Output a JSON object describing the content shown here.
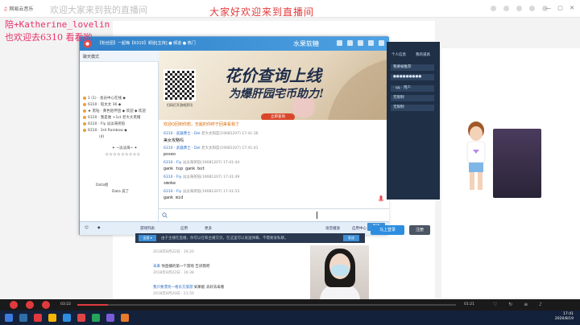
{
  "overlays": {
    "top_left_faint": "欢迎大家来到我的直播间",
    "top_center_red": "大家好欢迎来到直播间",
    "user_line": "陪+Katherine_lovelin",
    "welcome_line": "也欢迎去6310 看看哟"
  },
  "app": {
    "logo_prefix": "♫",
    "logo_name": "网易云音乐"
  },
  "yy": {
    "room_title": "【粉丝团】一起嗨【6310】频道[主持] ● 频道 ● 热门",
    "brand": "水果软糖",
    "list_mode": "聊天模式",
    "members": [
      "1 (1)  · 会员中心在线 ◆ ",
      "6310 · 陪太太 36 ◆",
      "★ 黑钻 · 黄色陪伴团 ◆ 欢迎 ◆ 欢迎",
      "6310 · 我是谁 +1st 老大大黑帽",
      "6310 · Fly 淡淡海英陪",
      "6310 · 3rd Rainbow ◆",
      "(4)",
      "✦ ~淡淡海~ ✦",
      "◇ ◇ ◇ ◇ ◇ ◇ ◇ ◇ ◇",
      "Dota组",
      "Data  说了"
    ],
    "banner": {
      "qr_caption": "扫码打开游戏资讯",
      "headline": "花价查询上线",
      "subline": "为爆肝园宅币助力!",
      "button": "立即查询"
    },
    "chat": [
      {
        "kind": "sys",
        "text": "欢迎Q回到你想，无敌的你终于回来看我了"
      },
      {
        "kind": "meta",
        "name": "6310 · 武器勇士 · Del",
        "text": "老大太阳篮(19081207) 17:41:36"
      },
      {
        "kind": "msg",
        "text": "美女攻略吗"
      },
      {
        "kind": "meta",
        "name": "6310 · 武器勇士 · Del",
        "text": "老大太阳篮(19081207) 17:41:41"
      },
      {
        "kind": "msg",
        "text": "poxeo"
      },
      {
        "kind": "meta",
        "name": "6310 · Fly",
        "text": "淡淡海英陪(19081207) 17:41:44"
      },
      {
        "kind": "msg",
        "text": "gank top  gank bot"
      },
      {
        "kind": "meta",
        "name": "6310 · Fly",
        "text": "淡淡海英陪(19081207) 17:41:49"
      },
      {
        "kind": "msg",
        "text": "smoke"
      },
      {
        "kind": "meta",
        "name": "6310 · Fly",
        "text": "淡淡海英陪(19081207) 17:41:53"
      },
      {
        "kind": "msg",
        "text": "gank mid"
      }
    ],
    "bottom": {
      "b1": "游戏列表",
      "b2": "应用",
      "b3": "更多",
      "b4": "语音播放",
      "b5": "应用中心",
      "send": "发送"
    },
    "side": {
      "tab1": "个人信息",
      "tab2": "我的道具",
      "fields": [
        "我要被推荐",
        "●●●●●●●●●",
        "· qq · 用户",
        "无限制",
        "无限制"
      ],
      "login": "马上登录",
      "register": "注册"
    },
    "prompt_bar": {
      "dropdown": "全部 ▾",
      "text": "由于主播在直播，你可以在和主播交流，在这里可以发送弹幕，不需要发私聊。",
      "button": "发送"
    }
  },
  "feed": [
    {
      "user": "2018年8月22日",
      "text": "· 16:20",
      "date": ""
    },
    {
      "user": "未来",
      "text": "你直播的第一个游戏 告诉我吧",
      "date": "2018年8月22日 · 16:38"
    },
    {
      "user": "我只要漂亮一格东方旅游",
      "text": "如果能 去好去再看",
      "date": "2018年8月20日 · 21:50"
    }
  ],
  "player": {
    "time_current": "03:22",
    "time_total": "01:21",
    "progress": 0.08
  },
  "clock": {
    "time": "17:41",
    "date": "2020/8/19"
  },
  "colors": {
    "accent": "#2f80c8",
    "red": "#e0393e",
    "dark_panel": "#1f2f45"
  }
}
